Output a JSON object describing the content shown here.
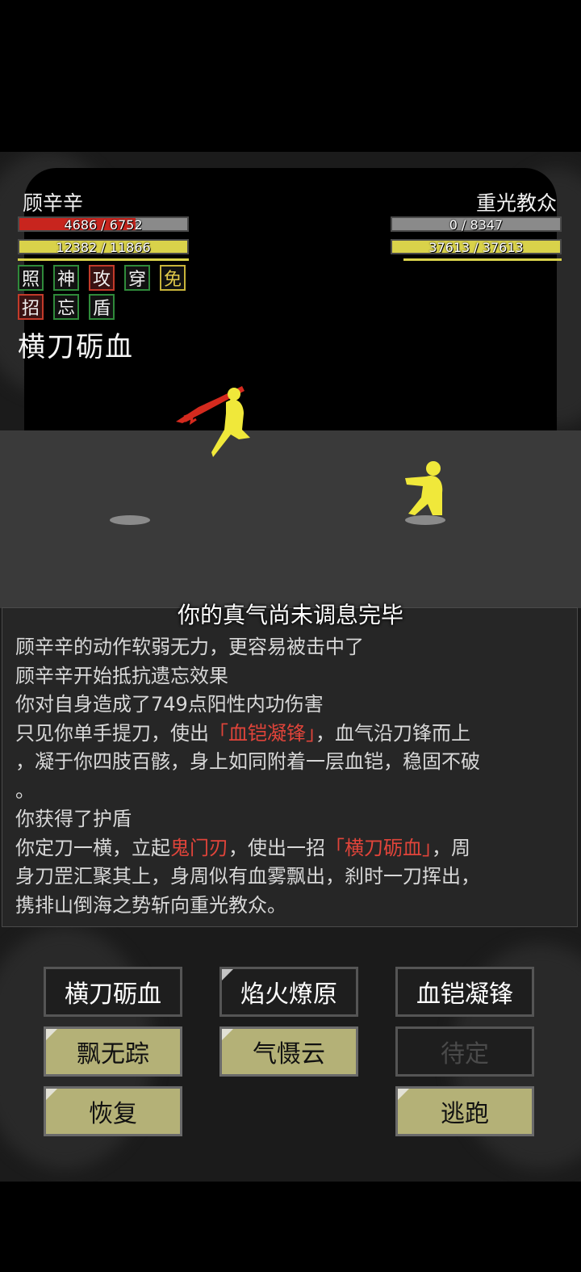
{
  "player": {
    "name": "顾辛辛",
    "hp_text": "4686 / 6752",
    "hp_fraction": 0.694,
    "mp_text": "12382 / 11866",
    "mp_fraction": 1.0,
    "statuses": [
      {
        "char": "照",
        "color": "#2f8a3a"
      },
      {
        "char": "神",
        "color": "#2f8a3a"
      },
      {
        "char": "攻",
        "color": "#c23a2a"
      },
      {
        "char": "穿",
        "color": "#2f8a3a"
      },
      {
        "char": "免",
        "color": "#c9b43a"
      },
      {
        "char": "招",
        "color": "#c23a2a"
      },
      {
        "char": "忘",
        "color": "#2f8a3a"
      },
      {
        "char": "盾",
        "color": "#2f8a3a"
      }
    ],
    "current_skill": "横刀砺血"
  },
  "enemy": {
    "name": "重光教众",
    "hp_text": "0 / 8347",
    "hp_fraction": 0.0,
    "mp_text": "37613 / 37613",
    "mp_fraction": 1.0
  },
  "colors": {
    "hp": "#c8251e",
    "mp": "#d9d24a",
    "figure": "#f0e83a",
    "blade": "#d42a1e"
  },
  "toast": "你的真气尚未调息完毕",
  "log": {
    "lines": [
      {
        "parts": [
          {
            "t": "顾辛辛的动作软弱无力，更容易被击中了",
            "hl": false
          }
        ]
      },
      {
        "parts": [
          {
            "t": "顾辛辛开始抵抗遗忘效果",
            "hl": false
          }
        ]
      },
      {
        "parts": [
          {
            "t": "你对自身造成了749点阳性内功伤害",
            "hl": false
          }
        ]
      },
      {
        "parts": [
          {
            "t": "只见你单手提刀，使出",
            "hl": false
          },
          {
            "t": "「血铠凝锋」",
            "hl": true
          },
          {
            "t": "，血气沿刀锋而上",
            "hl": false
          }
        ]
      },
      {
        "parts": [
          {
            "t": "，凝于你四肢百骸，身上如同附着一层血铠，稳固不破",
            "hl": false
          }
        ]
      },
      {
        "parts": [
          {
            "t": "。",
            "hl": false
          }
        ]
      },
      {
        "parts": [
          {
            "t": "你获得了护盾",
            "hl": false
          }
        ]
      },
      {
        "parts": [
          {
            "t": "你定刀一横，立起",
            "hl": false
          },
          {
            "t": "鬼门刃",
            "hl": true
          },
          {
            "t": "，使出一招",
            "hl": false
          },
          {
            "t": "「横刀砺血」",
            "hl": true
          },
          {
            "t": "，周",
            "hl": false
          }
        ]
      },
      {
        "parts": [
          {
            "t": "身刀罡汇聚其上，身周似有血雾飘出，刹时一刀挥出，",
            "hl": false
          }
        ]
      },
      {
        "parts": [
          {
            "t": "携排山倒海之势斩向重光教众。",
            "hl": false
          }
        ]
      }
    ]
  },
  "actions": [
    {
      "label": "横刀砺血",
      "style": "dark",
      "notch": false
    },
    {
      "label": "焰火燎原",
      "style": "dark",
      "notch": true
    },
    {
      "label": "血铠凝锋",
      "style": "dark",
      "notch": false
    },
    {
      "label": "飘无踪",
      "style": "olive",
      "notch": true
    },
    {
      "label": "气慑云",
      "style": "olive",
      "notch": true
    },
    {
      "label": "待定",
      "style": "disabled",
      "notch": false
    },
    {
      "label": "恢复",
      "style": "olive",
      "notch": true
    },
    {
      "label": "逃跑",
      "style": "olive",
      "notch": true
    }
  ]
}
